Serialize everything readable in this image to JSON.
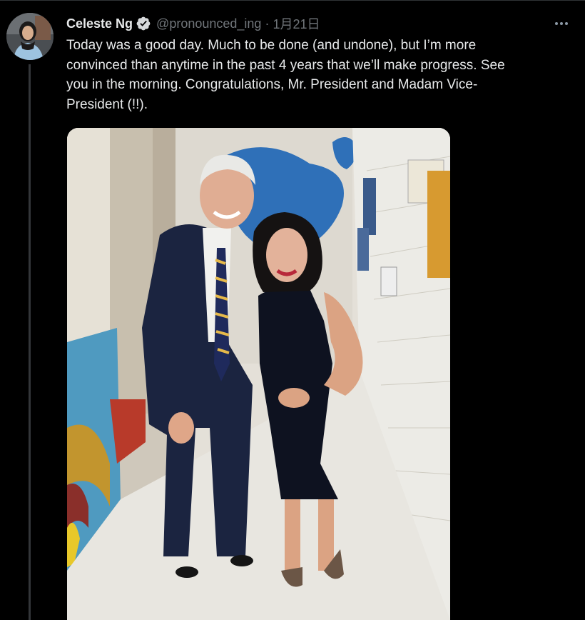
{
  "tweet": {
    "display_name": "Celeste Ng",
    "handle": "@pronounced_ing",
    "separator": "·",
    "date": "1月21日",
    "text_lines": [
      "Today was a good day. Much to be done (and undone), but I’m more",
      "convinced than anytime in the past 4 years that we’ll make progress. See",
      "you in the morning. Congratulations, Mr. President and Madam Vice-",
      "President (!!)."
    ]
  },
  "icons": {
    "verified": "verified-badge-icon",
    "more": "more-options-icon"
  },
  "colors": {
    "background": "#000000",
    "primary_text": "#e7e9ea",
    "secondary_text": "#71767b",
    "thread_line": "#333639"
  }
}
